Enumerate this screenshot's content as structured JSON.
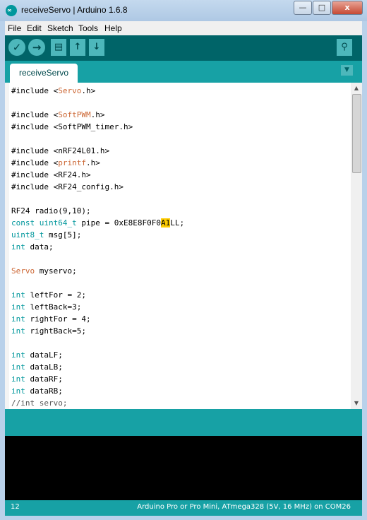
{
  "window": {
    "title": "receiveServo | Arduino 1.6.8",
    "app_icon_glyph": "∞",
    "minimize_glyph": "—",
    "maximize_glyph": "□",
    "close_glyph": "x"
  },
  "menu": [
    "File",
    "Edit",
    "Sketch",
    "Tools",
    "Help"
  ],
  "toolbar": {
    "verify_glyph": "✓",
    "upload_glyph": "→",
    "new_glyph": "▤",
    "open_glyph": "↑",
    "save_glyph": "↓",
    "serial_monitor_glyph": "⚲"
  },
  "tabs": [
    {
      "label": "receiveServo"
    }
  ],
  "tab_menu_glyph": "▼",
  "code": [
    [
      {
        "t": "#include <"
      },
      {
        "t": "Servo",
        "c": "kw-orange"
      },
      {
        "t": ".h>"
      }
    ],
    [],
    [
      {
        "t": "#include <"
      },
      {
        "t": "SoftPWM",
        "c": "kw-orange"
      },
      {
        "t": ".h>"
      }
    ],
    [
      {
        "t": "#include <SoftPWM_timer.h>"
      }
    ],
    [],
    [
      {
        "t": "#include <nRF24L01.h>"
      }
    ],
    [
      {
        "t": "#include <"
      },
      {
        "t": "printf",
        "c": "kw-orange"
      },
      {
        "t": ".h>"
      }
    ],
    [
      {
        "t": "#include <RF24.h>"
      }
    ],
    [
      {
        "t": "#include <RF24_config.h>"
      }
    ],
    [],
    [
      {
        "t": "RF24 radio(9,10);"
      }
    ],
    [
      {
        "t": "const",
        "c": "kw-blue"
      },
      {
        "t": " "
      },
      {
        "t": "uint64_t",
        "c": "kw-blue"
      },
      {
        "t": " pipe = 0xE8E8F0F0"
      },
      {
        "t": "A1",
        "c": "hl"
      },
      {
        "t": "LL;"
      }
    ],
    [
      {
        "t": "uint8_t",
        "c": "kw-blue"
      },
      {
        "t": " msg[5];"
      }
    ],
    [
      {
        "t": "int",
        "c": "kw-blue"
      },
      {
        "t": " data;"
      }
    ],
    [],
    [
      {
        "t": "Servo",
        "c": "kw-orange"
      },
      {
        "t": " myservo;"
      }
    ],
    [],
    [
      {
        "t": "int",
        "c": "kw-blue"
      },
      {
        "t": " leftFor = 2;"
      }
    ],
    [
      {
        "t": "int",
        "c": "kw-blue"
      },
      {
        "t": " leftBack=3;"
      }
    ],
    [
      {
        "t": "int",
        "c": "kw-blue"
      },
      {
        "t": " rightFor = 4;"
      }
    ],
    [
      {
        "t": "int",
        "c": "kw-blue"
      },
      {
        "t": " rightBack=5;"
      }
    ],
    [],
    [
      {
        "t": "int",
        "c": "kw-blue"
      },
      {
        "t": " dataLF;"
      }
    ],
    [
      {
        "t": "int",
        "c": "kw-blue"
      },
      {
        "t": " dataLB;"
      }
    ],
    [
      {
        "t": "int",
        "c": "kw-blue"
      },
      {
        "t": " dataRF;"
      }
    ],
    [
      {
        "t": "int",
        "c": "kw-blue"
      },
      {
        "t": " dataRB;"
      }
    ],
    [
      {
        "t": "//int servo;",
        "c": "cmt"
      }
    ]
  ],
  "scrollbar": {
    "up_glyph": "▲",
    "down_glyph": "▼"
  },
  "status": {
    "line_number": "12",
    "board": "Arduino Pro or Pro Mini, ATmega328 (5V, 16 MHz) on COM26"
  },
  "colors": {
    "teal_dark": "#006468",
    "teal": "#17a1a5",
    "keyword_orange": "#cc6633",
    "keyword_blue": "#00979c",
    "highlight": "#ffcc00"
  }
}
